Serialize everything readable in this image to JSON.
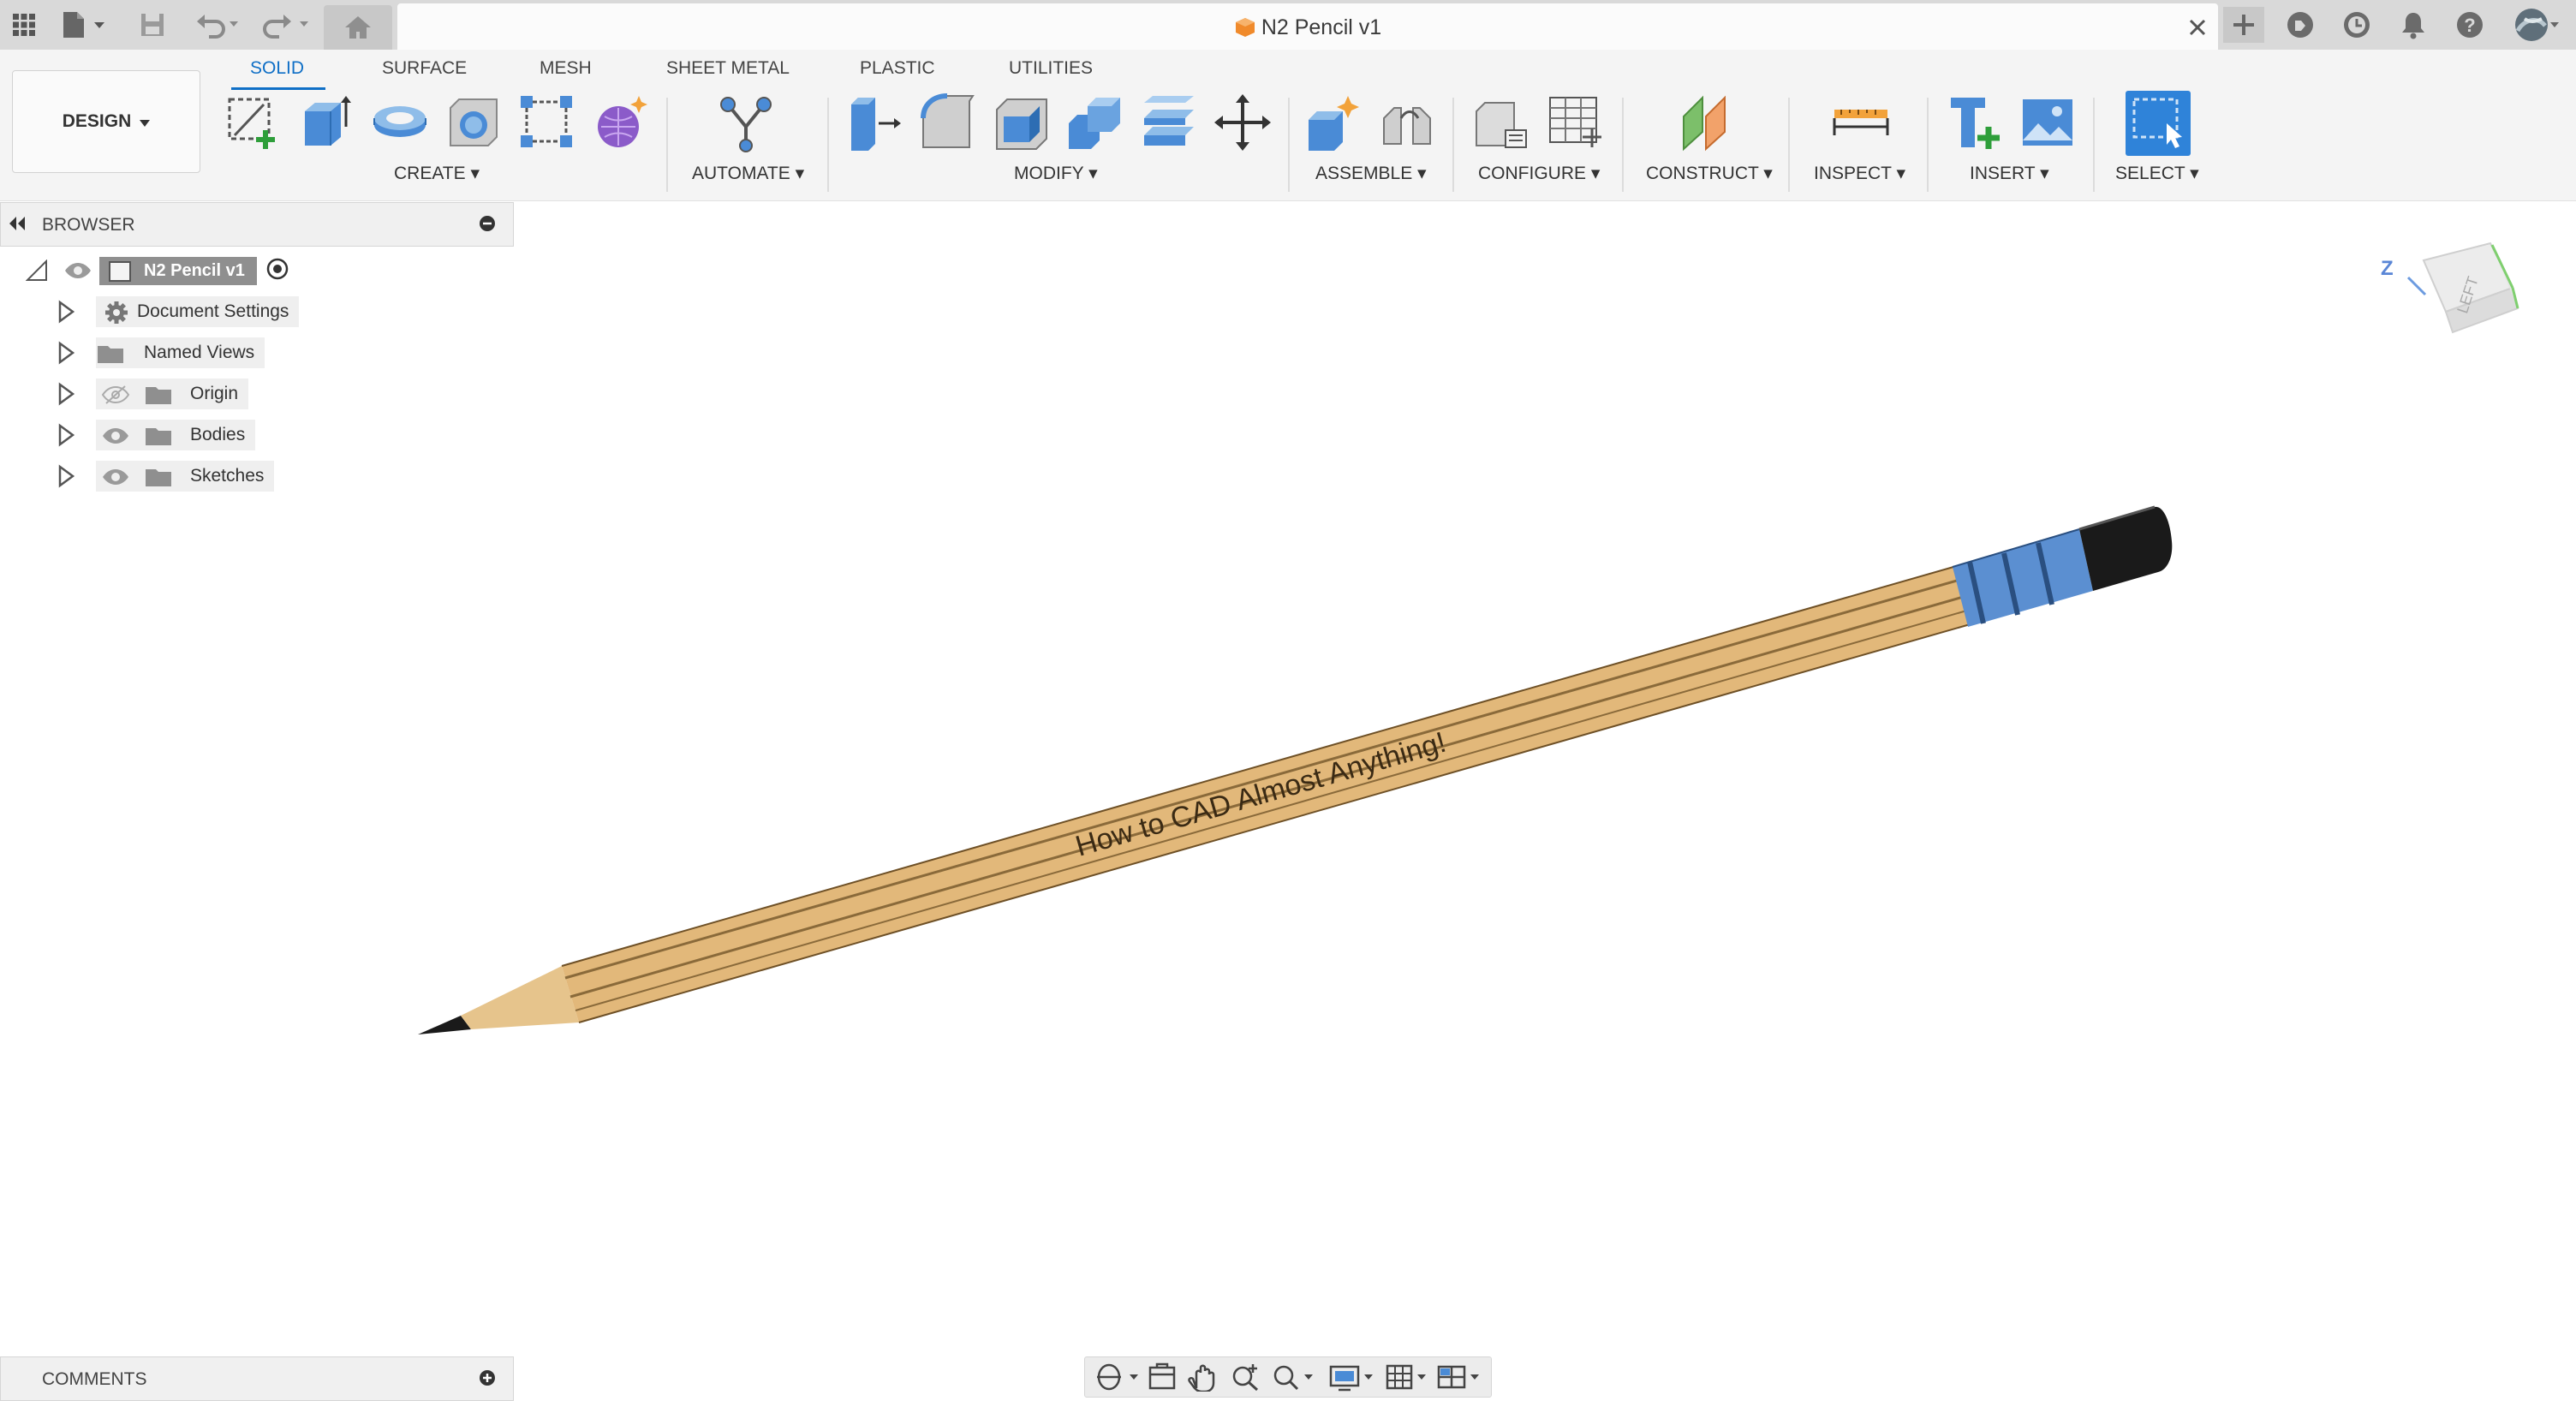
{
  "window": {
    "title": "N2 Pencil v1"
  },
  "topbar": {
    "left_icons": [
      "apps-grid-icon",
      "file-icon",
      "save-icon",
      "undo-icon",
      "redo-icon",
      "home-icon"
    ],
    "right_icons": [
      "new-tab-icon",
      "extensions-icon",
      "job-status-icon",
      "notifications-icon",
      "help-icon",
      "user-avatar"
    ]
  },
  "ribbon": {
    "workspace_button": "DESIGN",
    "tabs": [
      {
        "label": "SOLID",
        "active": true
      },
      {
        "label": "SURFACE"
      },
      {
        "label": "MESH"
      },
      {
        "label": "SHEET METAL"
      },
      {
        "label": "PLASTIC"
      },
      {
        "label": "UTILITIES"
      }
    ],
    "groups": [
      {
        "label": "CREATE"
      },
      {
        "label": "AUTOMATE"
      },
      {
        "label": "MODIFY"
      },
      {
        "label": "ASSEMBLE"
      },
      {
        "label": "CONFIGURE"
      },
      {
        "label": "CONSTRUCT"
      },
      {
        "label": "INSPECT"
      },
      {
        "label": "INSERT"
      },
      {
        "label": "SELECT"
      }
    ]
  },
  "browser": {
    "title": "BROWSER",
    "root": "N2 Pencil v1",
    "items": [
      {
        "label": "Document Settings",
        "icon": "gear-icon"
      },
      {
        "label": "Named Views",
        "icon": "folder-icon"
      },
      {
        "label": "Origin",
        "icon": "folder-icon",
        "visibility": "hidden"
      },
      {
        "label": "Bodies",
        "icon": "folder-icon",
        "visibility": "visible"
      },
      {
        "label": "Sketches",
        "icon": "folder-icon",
        "visibility": "visible"
      }
    ]
  },
  "viewcube": {
    "axis_label": "Z",
    "face_label": "LEFT"
  },
  "canvas": {
    "engraving_text": "How to CAD Almost Anything!"
  },
  "comments": {
    "title": "COMMENTS"
  },
  "colors": {
    "accent": "#0f6fc6",
    "wood": "#e2b87a",
    "ferrule": "#5b8fd1",
    "eraser": "#1a1a1a"
  }
}
